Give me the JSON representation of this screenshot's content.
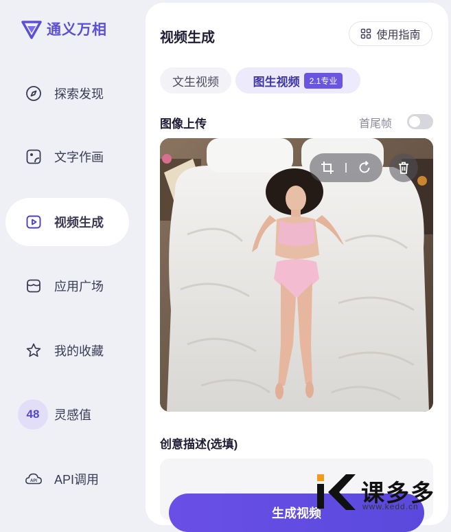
{
  "brand": {
    "name": "通义万相",
    "logo_icon": "tongyi-logo-icon",
    "color": "#5b4fd6"
  },
  "sidebar": {
    "items": [
      {
        "label": "探索发现",
        "icon": "compass-icon",
        "active": false
      },
      {
        "label": "文字作画",
        "icon": "image-frame-icon",
        "active": false
      },
      {
        "label": "视频生成",
        "icon": "play-icon",
        "active": true
      },
      {
        "label": "应用广场",
        "icon": "store-icon",
        "active": false
      },
      {
        "label": "我的收藏",
        "icon": "star-icon",
        "active": false
      },
      {
        "label": "灵感值",
        "badge": "48",
        "active": false
      },
      {
        "label": "API调用",
        "icon": "api-cloud-icon",
        "active": false
      }
    ]
  },
  "main": {
    "title": "视频生成",
    "guide_button": "使用指南",
    "tabs": [
      {
        "label": "文生视频",
        "active": false
      },
      {
        "label": "图生视频",
        "tag": "2.1专业",
        "active": true
      }
    ],
    "upload_label": "图像上传",
    "first_last_frame_label": "首尾帧",
    "first_last_frame_enabled": false,
    "image_tools": [
      "crop-icon",
      "rotate-icon",
      "trash-icon"
    ],
    "prompt_label": "创意描述(选填)",
    "generate_button": "生成视频"
  },
  "watermark": {
    "text": "课多多",
    "url": "www.kedd.cn"
  },
  "colors": {
    "accent": "#6a55e0",
    "active_tab_bg": "#eceafb",
    "page_bg": "#eef0f6"
  }
}
